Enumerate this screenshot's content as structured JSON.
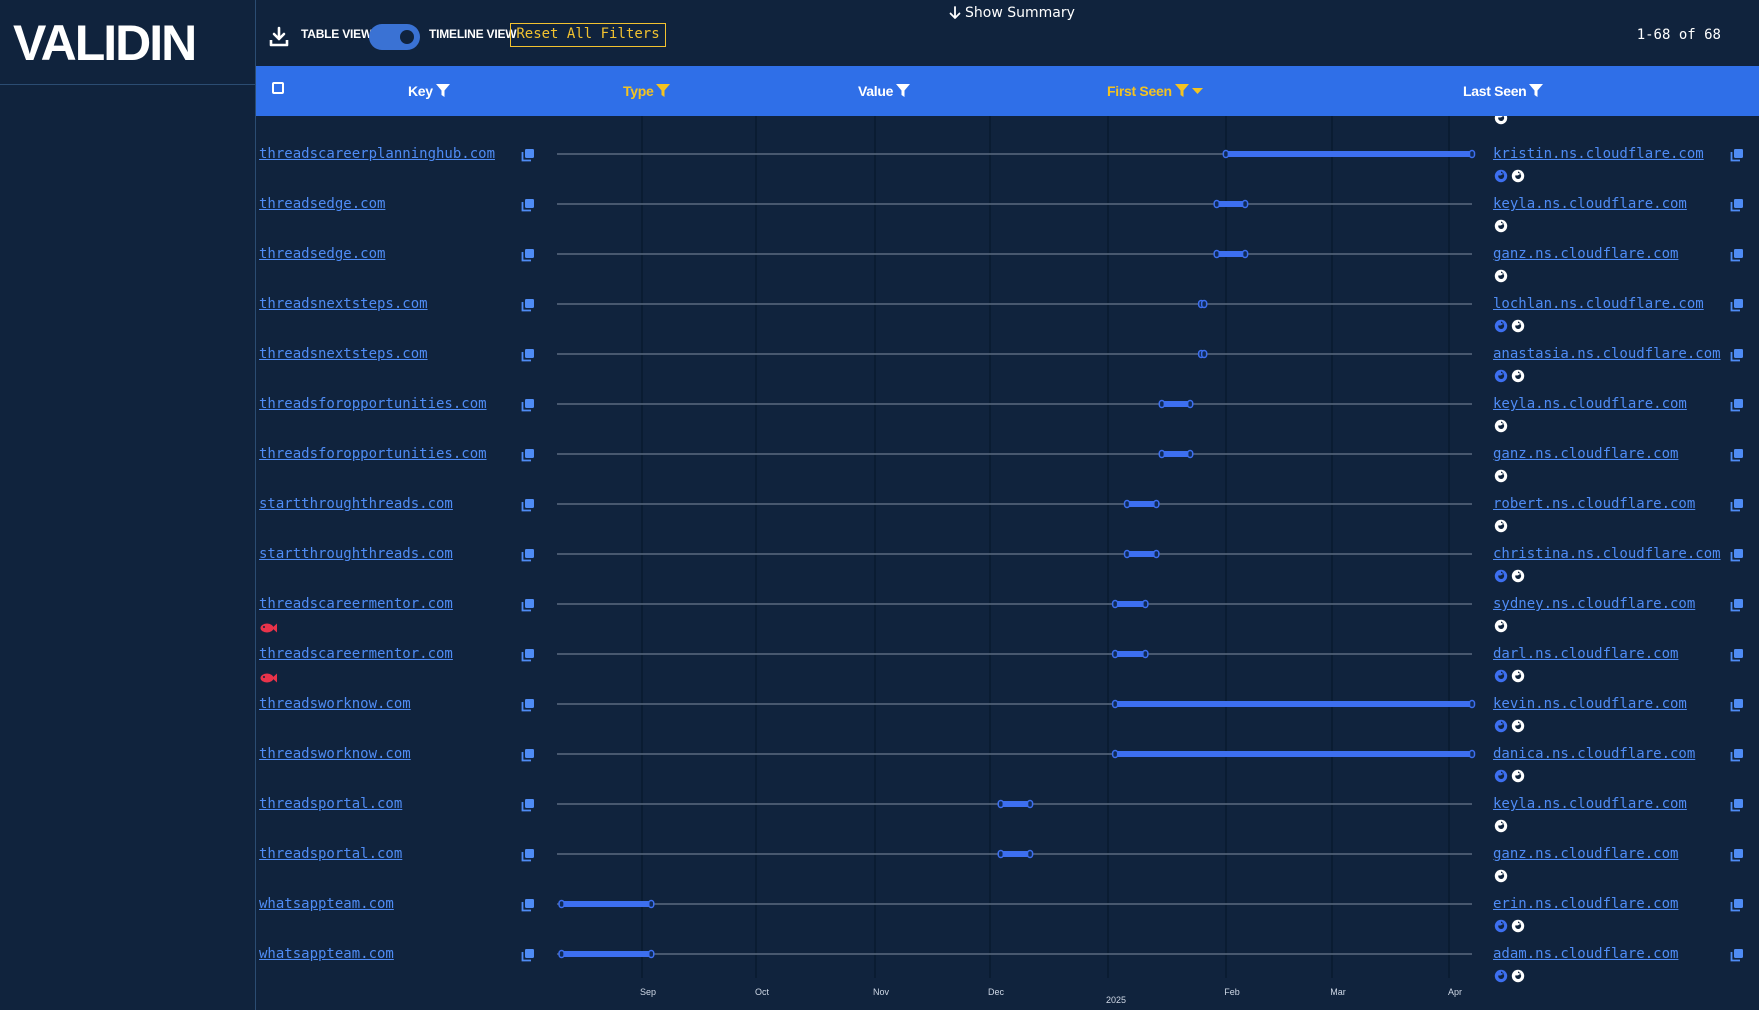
{
  "app": {
    "logo_text": "VALIDIN"
  },
  "toolbar": {
    "table_view_label": "TABLE VIEW",
    "timeline_view_label": "TIMELINE VIEW",
    "reset_label": "Reset All Filters",
    "summary_label": "Show Summary",
    "page_count": "1-68 of 68",
    "view_mode": "timeline"
  },
  "columns": {
    "key": "Key",
    "type": "Type",
    "value": "Value",
    "first_seen": "First Seen",
    "last_seen": "Last Seen",
    "active_filter_color": "#f4c320",
    "sort": "first_seen_desc"
  },
  "timeline": {
    "month_labels": [
      "Sep",
      "Oct",
      "Nov",
      "Dec",
      "2025",
      "Feb",
      "Mar",
      "Apr"
    ]
  },
  "rows": [
    {
      "key": "threadscareerplanninghub.com",
      "value": "kristin.ns.cloudflare.com",
      "start": 0.731,
      "end": 1.0,
      "icons": [
        "blue",
        "white"
      ],
      "phish": false
    },
    {
      "key": "threadsedge.com",
      "value": "keyla.ns.cloudflare.com",
      "start": 0.721,
      "end": 0.752,
      "icons": [
        "white"
      ],
      "phish": false
    },
    {
      "key": "threadsedge.com",
      "value": "ganz.ns.cloudflare.com",
      "start": 0.721,
      "end": 0.752,
      "icons": [
        "white"
      ],
      "phish": false
    },
    {
      "key": "threadsnextsteps.com",
      "value": "lochlan.ns.cloudflare.com",
      "start": 0.704,
      "end": 0.707,
      "icons": [
        "blue",
        "white"
      ],
      "phish": false
    },
    {
      "key": "threadsnextsteps.com",
      "value": "anastasia.ns.cloudflare.com",
      "start": 0.704,
      "end": 0.707,
      "icons": [
        "blue",
        "white"
      ],
      "phish": false
    },
    {
      "key": "threadsforopportunities.com",
      "value": "keyla.ns.cloudflare.com",
      "start": 0.661,
      "end": 0.692,
      "icons": [
        "white"
      ],
      "phish": false
    },
    {
      "key": "threadsforopportunities.com",
      "value": "ganz.ns.cloudflare.com",
      "start": 0.661,
      "end": 0.692,
      "icons": [
        "white"
      ],
      "phish": false
    },
    {
      "key": "startthroughthreads.com",
      "value": "robert.ns.cloudflare.com",
      "start": 0.623,
      "end": 0.655,
      "icons": [
        "white"
      ],
      "phish": false
    },
    {
      "key": "startthroughthreads.com",
      "value": "christina.ns.cloudflare.com",
      "start": 0.623,
      "end": 0.655,
      "icons": [
        "blue",
        "white"
      ],
      "phish": false
    },
    {
      "key": "threadscareermentor.com",
      "value": "sydney.ns.cloudflare.com",
      "start": 0.61,
      "end": 0.643,
      "icons": [
        "white"
      ],
      "phish": true
    },
    {
      "key": "threadscareermentor.com",
      "value": "darl.ns.cloudflare.com",
      "start": 0.61,
      "end": 0.643,
      "icons": [
        "blue",
        "white"
      ],
      "phish": true
    },
    {
      "key": "threadsworknow.com",
      "value": "kevin.ns.cloudflare.com",
      "start": 0.61,
      "end": 1.0,
      "icons": [
        "blue",
        "white"
      ],
      "phish": false
    },
    {
      "key": "threadsworknow.com",
      "value": "danica.ns.cloudflare.com",
      "start": 0.61,
      "end": 1.0,
      "icons": [
        "blue",
        "white"
      ],
      "phish": false
    },
    {
      "key": "threadsportal.com",
      "value": "keyla.ns.cloudflare.com",
      "start": 0.485,
      "end": 0.517,
      "icons": [
        "white"
      ],
      "phish": false
    },
    {
      "key": "threadsportal.com",
      "value": "ganz.ns.cloudflare.com",
      "start": 0.485,
      "end": 0.517,
      "icons": [
        "white"
      ],
      "phish": false
    },
    {
      "key": "whatsappteam.com",
      "value": "erin.ns.cloudflare.com",
      "start": 0.005,
      "end": 0.103,
      "icons": [
        "blue",
        "white"
      ],
      "phish": false
    },
    {
      "key": "whatsappteam.com",
      "value": "adam.ns.cloudflare.com",
      "start": 0.005,
      "end": 0.103,
      "icons": [
        "blue",
        "white"
      ],
      "phish": false
    }
  ],
  "colors": {
    "background": "#10233d",
    "header": "#2f6fe8",
    "link": "#4f8cf5",
    "bar": "#3d6ff0",
    "accent_yellow": "#f4c320",
    "phish": "#e8334a"
  }
}
